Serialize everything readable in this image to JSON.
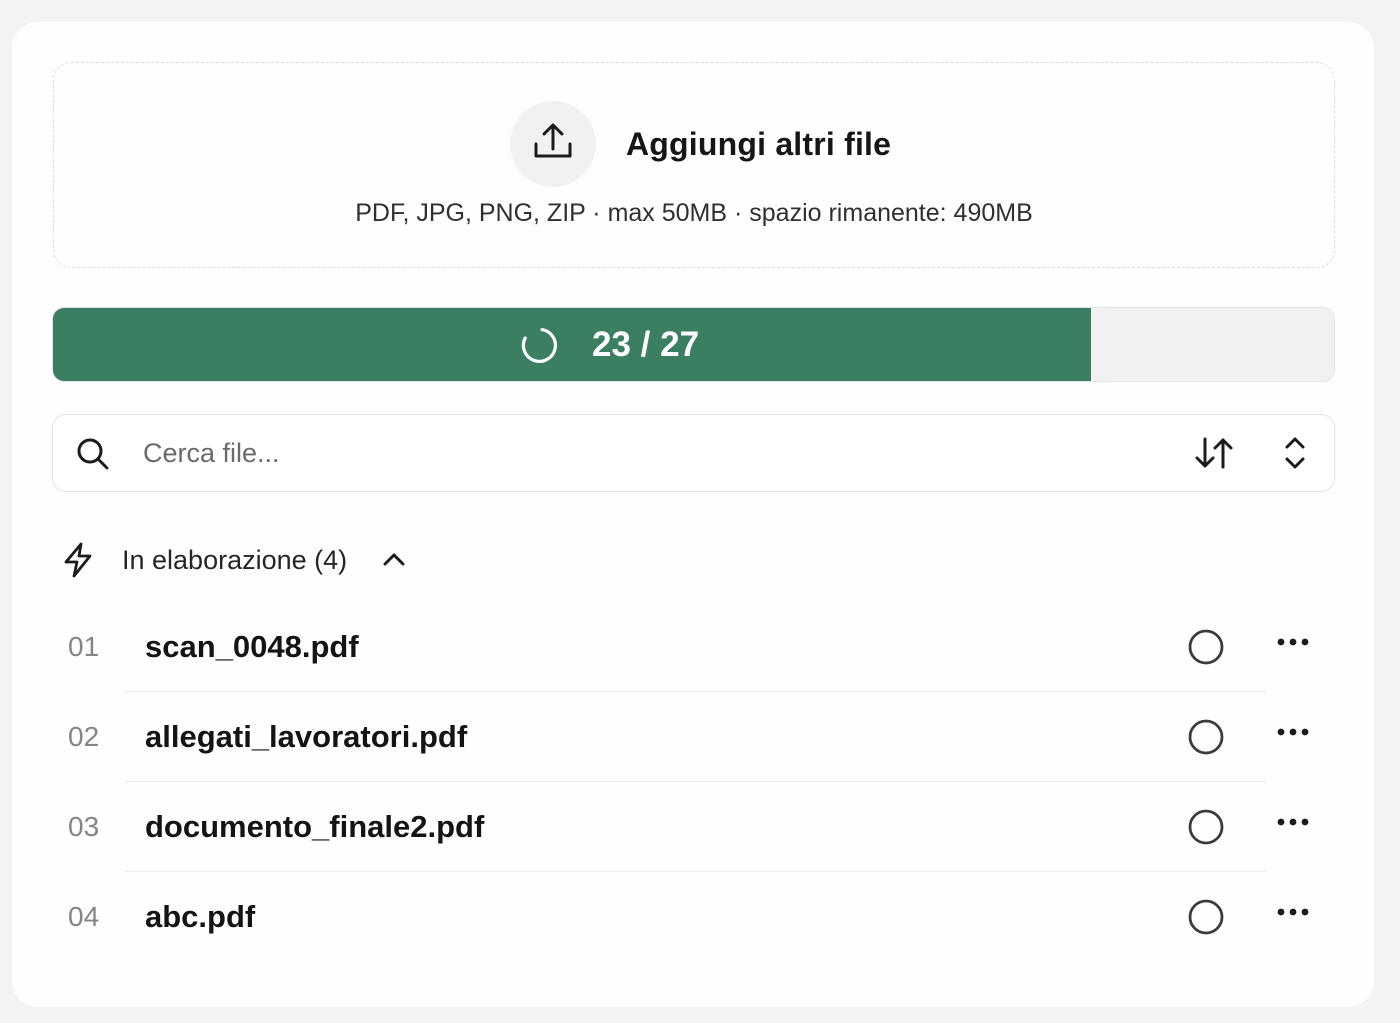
{
  "upload": {
    "icon": "upload-icon",
    "title": "Aggiungi altri file",
    "subtitle": "PDF, JPG, PNG, ZIP · max 50MB · spazio rimanente: 490MB"
  },
  "progress": {
    "label": "23 / 27",
    "completed": 23,
    "total": 27,
    "fraction": 0.81,
    "fill_color": "#3a7f62",
    "icon": "spinner-icon"
  },
  "search": {
    "placeholder": "Cerca file...",
    "value": "",
    "icons": [
      "search-icon",
      "sort-icon",
      "chevron-up-down-icon"
    ]
  },
  "section": {
    "icon": "lightning-icon",
    "label": "In elaborazione (4)",
    "expanded": true
  },
  "files": [
    {
      "num": "01",
      "name": "scan_0048.pdf"
    },
    {
      "num": "02",
      "name": "allegati_lavoratori.pdf"
    },
    {
      "num": "03",
      "name": "documento_finale2.pdf"
    },
    {
      "num": "04",
      "name": "abc.pdf"
    }
  ],
  "colors": {
    "accent": "#3a7f62",
    "background": "#f4f3f1",
    "card": "#fefefe"
  }
}
